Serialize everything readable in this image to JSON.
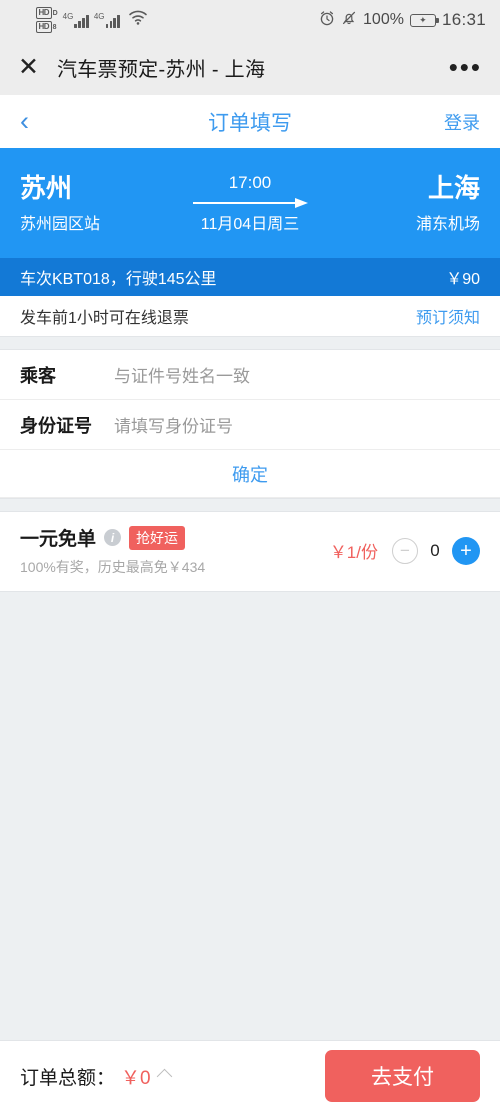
{
  "statusbar": {
    "hd1": "HD",
    "hd1_sub": "D",
    "hd2": "HD",
    "hd2_sub": "8",
    "net1": "4G",
    "net2": "4G",
    "wifi_icon": "wifi-icon",
    "alarm_icon": "alarm-icon",
    "mute_icon": "bell-muted-icon",
    "battery_pct": "100%",
    "battery_icon": "battery-charging-icon",
    "time": "16:31"
  },
  "titlebar": {
    "close_icon": "close-icon",
    "title": "汽车票预定-苏州 - 上海",
    "more_icon": "more-dots-icon"
  },
  "navbar": {
    "back_icon": "chevron-left-icon",
    "title": "订单填写",
    "login": "登录"
  },
  "route": {
    "from_city": "苏州",
    "from_station": "苏州园区站",
    "depart_time": "17:00",
    "date": "11月04日周三",
    "arrow_icon": "arrow-right-icon",
    "to_city": "上海",
    "to_station": "浦东机场"
  },
  "trip": {
    "info": "车次KBT018，行驶145公里",
    "price": "￥90"
  },
  "refund": {
    "policy": "发车前1小时可在线退票",
    "notice_link": "预订须知"
  },
  "form": {
    "rows": [
      {
        "label": "乘客",
        "value": "",
        "placeholder": "与证件号姓名一致"
      },
      {
        "label": "身份证号",
        "value": "",
        "placeholder": "请填写身份证号"
      }
    ],
    "confirm": "确定"
  },
  "promo": {
    "title": "一元免单",
    "info_icon": "info-icon",
    "badge": "抢好运",
    "subtitle": "100%有奖，历史最高免￥434",
    "unit_price": "￥1/份",
    "minus_icon": "minus-circle-icon",
    "count": "0",
    "plus_icon": "plus-circle-icon"
  },
  "bottombar": {
    "total_label": "订单总额：",
    "total_amount": "￥0",
    "expand_icon": "chevron-up-icon",
    "pay_button": "去支付"
  },
  "colors": {
    "accent_blue": "#2196F3",
    "deep_blue": "#1379D6",
    "link_blue": "#3E9BEF",
    "accent_red": "#F0615E",
    "page_bg": "#EDF0F2"
  }
}
